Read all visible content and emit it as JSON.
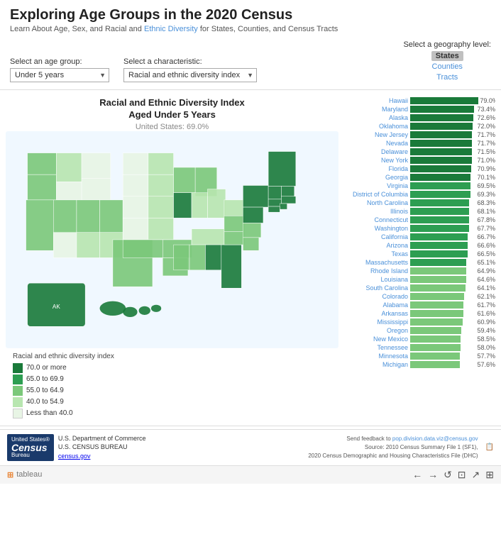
{
  "header": {
    "title": "Exploring Age Groups in the 2020 Census",
    "subtitle_plain": "Learn About Age, Sex, and Racial and ",
    "subtitle_link": "Ethnic Diversity",
    "subtitle_end": " for States, Counties, and Census Tracts"
  },
  "controls": {
    "age_label": "Select an age group:",
    "age_value": "Under 5 years",
    "char_label": "Select a characteristic:",
    "char_value": "Racial and ethnic diversity index",
    "geo_label": "Select a geography level:",
    "geo_options": [
      "States",
      "Counties",
      "Tracts"
    ],
    "geo_active": "States"
  },
  "chart": {
    "title_line1": "Racial and Ethnic Diversity Index",
    "title_line2": "Aged Under 5 Years",
    "subtitle": "United States: 69.0%"
  },
  "legend": {
    "title": "Racial and ethnic diversity index",
    "items": [
      {
        "label": "70.0 or more",
        "color": "#1a7a3a"
      },
      {
        "label": "65.0 to 69.9",
        "color": "#2d9e52"
      },
      {
        "label": "55.0 to 64.9",
        "color": "#7bc87a"
      },
      {
        "label": "40.0 to 54.9",
        "color": "#b8e6b0"
      },
      {
        "label": "Less than 40.0",
        "color": "#e8f5e5"
      }
    ]
  },
  "bars": [
    {
      "state": "Hawaii",
      "value": 79.0,
      "pct": "79.0%"
    },
    {
      "state": "Maryland",
      "value": 73.4,
      "pct": "73.4%"
    },
    {
      "state": "Alaska",
      "value": 72.6,
      "pct": "72.6%"
    },
    {
      "state": "Oklahoma",
      "value": 72.0,
      "pct": "72.0%"
    },
    {
      "state": "New Jersey",
      "value": 71.7,
      "pct": "71.7%"
    },
    {
      "state": "Nevada",
      "value": 71.7,
      "pct": "71.7%"
    },
    {
      "state": "Delaware",
      "value": 71.5,
      "pct": "71.5%"
    },
    {
      "state": "New York",
      "value": 71.0,
      "pct": "71.0%"
    },
    {
      "state": "Florida",
      "value": 70.9,
      "pct": "70.9%"
    },
    {
      "state": "Georgia",
      "value": 70.1,
      "pct": "70.1%"
    },
    {
      "state": "Virginia",
      "value": 69.5,
      "pct": "69.5%"
    },
    {
      "state": "District of Columbia",
      "value": 69.3,
      "pct": "69.3%"
    },
    {
      "state": "North Carolina",
      "value": 68.3,
      "pct": "68.3%"
    },
    {
      "state": "Illinois",
      "value": 68.1,
      "pct": "68.1%"
    },
    {
      "state": "Connecticut",
      "value": 67.8,
      "pct": "67.8%"
    },
    {
      "state": "Washington",
      "value": 67.7,
      "pct": "67.7%"
    },
    {
      "state": "California",
      "value": 66.7,
      "pct": "66.7%"
    },
    {
      "state": "Arizona",
      "value": 66.6,
      "pct": "66.6%"
    },
    {
      "state": "Texas",
      "value": 66.5,
      "pct": "66.5%"
    },
    {
      "state": "Massachusetts",
      "value": 65.1,
      "pct": "65.1%"
    },
    {
      "state": "Rhode Island",
      "value": 64.9,
      "pct": "64.9%"
    },
    {
      "state": "Louisiana",
      "value": 64.6,
      "pct": "64.6%"
    },
    {
      "state": "South Carolina",
      "value": 64.1,
      "pct": "64.1%"
    },
    {
      "state": "Colorado",
      "value": 62.1,
      "pct": "62.1%"
    },
    {
      "state": "Alabama",
      "value": 61.7,
      "pct": "61.7%"
    },
    {
      "state": "Arkansas",
      "value": 61.6,
      "pct": "61.6%"
    },
    {
      "state": "Mississippi",
      "value": 60.9,
      "pct": "60.9%"
    },
    {
      "state": "Oregon",
      "value": 59.4,
      "pct": "59.4%"
    },
    {
      "state": "New Mexico",
      "value": 58.5,
      "pct": "58.5%"
    },
    {
      "state": "Tennessee",
      "value": 58.0,
      "pct": "58.0%"
    },
    {
      "state": "Minnesota",
      "value": 57.7,
      "pct": "57.7%"
    },
    {
      "state": "Michigan",
      "value": 57.6,
      "pct": "57.6%"
    }
  ],
  "footer": {
    "logo_text": "Census",
    "dept_line1": "U.S. Department of Commerce",
    "dept_line2": "U.S. CENSUS BUREAU",
    "dept_line3": "census.gov",
    "feedback": "Send feedback to pop.division.data.viz@census.gov",
    "source1": "Source: 2010 Census Summary File 1 (SF1),",
    "source2": "2020 Census Demographic and Housing Characteristics File (DHC)"
  },
  "tableau": {
    "logo": "tableau",
    "nav_buttons": [
      "←",
      "→",
      "↺",
      "⊡",
      "↗",
      "⊞"
    ]
  }
}
